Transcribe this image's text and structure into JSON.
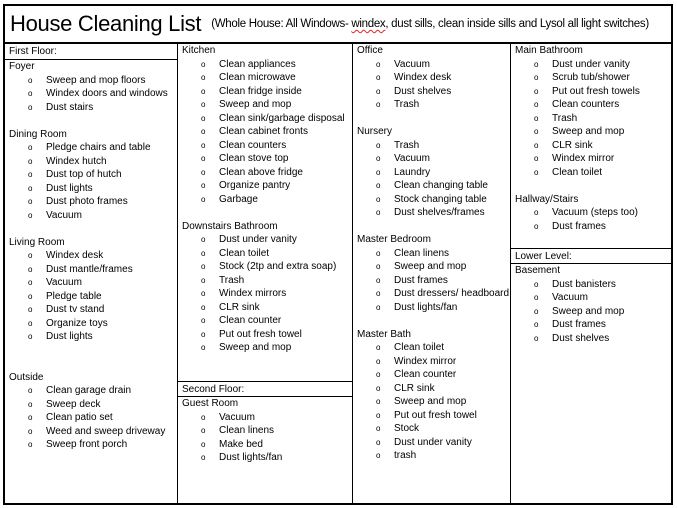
{
  "header": {
    "title": "House Cleaning List",
    "subtitle_pre": "(Whole House: All Windows- ",
    "subtitle_misspelled": "windex",
    "subtitle_post": ", dust sills, clean inside sills and Lysol all light switches)"
  },
  "bullet": "o",
  "floors": {
    "first": "First Floor:",
    "second": "Second Floor:",
    "lower": "Lower Level:"
  },
  "rooms": {
    "foyer": {
      "title": "Foyer",
      "tasks": [
        "Sweep and mop floors",
        "Windex doors and windows",
        "Dust stairs"
      ]
    },
    "dining": {
      "title": "Dining Room",
      "tasks": [
        "Pledge chairs and table",
        "Windex hutch",
        "Dust top of hutch",
        "Dust lights",
        "Dust photo frames",
        "Vacuum"
      ]
    },
    "living": {
      "title": "Living Room",
      "tasks": [
        "Windex desk",
        "Dust mantle/frames",
        "Vacuum",
        "Pledge table",
        "Dust tv stand",
        "Organize toys",
        "Dust lights"
      ]
    },
    "outside": {
      "title": "Outside",
      "tasks": [
        "Clean garage drain",
        "Sweep deck",
        "Clean patio set",
        "Weed and sweep driveway",
        "Sweep front porch"
      ]
    },
    "kitchen": {
      "title": "Kitchen",
      "tasks": [
        "Clean appliances",
        "Clean microwave",
        "Clean fridge inside",
        "Sweep and mop",
        "Clean sink/garbage disposal",
        "Clean cabinet fronts",
        "Clean counters",
        "Clean stove top",
        "Clean above fridge",
        "Organize pantry",
        "Garbage"
      ]
    },
    "downstairs_bath": {
      "title": "Downstairs Bathroom",
      "tasks": [
        "Dust under vanity",
        "Clean toilet",
        "Stock (2tp and extra soap)",
        "Trash",
        "Windex mirrors",
        "CLR sink",
        "Clean counter",
        "Put out fresh towel",
        "Sweep and mop"
      ]
    },
    "guest": {
      "title": "Guest Room",
      "tasks": [
        "Vacuum",
        "Clean linens",
        "Make bed",
        "Dust lights/fan"
      ]
    },
    "office": {
      "title": "Office",
      "tasks": [
        "Vacuum",
        "Windex desk",
        "Dust shelves",
        "Trash"
      ]
    },
    "nursery": {
      "title": "Nursery",
      "tasks": [
        "Trash",
        "Vacuum",
        "Laundry",
        "Clean changing table",
        "Stock changing table",
        "Dust shelves/frames"
      ]
    },
    "master_bedroom": {
      "title": "Master Bedroom",
      "tasks": [
        "Clean linens",
        "Sweep and mop",
        "Dust frames",
        "Dust dressers/ headboard",
        "Dust lights/fan"
      ]
    },
    "master_bath": {
      "title": "Master Bath",
      "tasks": [
        "Clean toilet",
        "Windex mirror",
        "Clean counter",
        "CLR sink",
        "Sweep and mop",
        "Put out fresh towel",
        "Stock",
        "Dust under vanity",
        "trash"
      ]
    },
    "main_bath": {
      "title": "Main Bathroom",
      "tasks": [
        "Dust under vanity",
        "Scrub tub/shower",
        "Put out fresh towels",
        "Clean counters",
        "Trash",
        "Sweep and mop",
        "CLR sink",
        "Windex mirror",
        "Clean toilet"
      ]
    },
    "hallway": {
      "title": "Hallway/Stairs",
      "tasks": [
        "Vacuum (steps too)",
        "Dust frames"
      ]
    },
    "basement": {
      "title": "Basement",
      "tasks": [
        "Dust banisters",
        "Vacuum",
        "Sweep and mop",
        "Dust frames",
        "Dust shelves"
      ]
    }
  }
}
